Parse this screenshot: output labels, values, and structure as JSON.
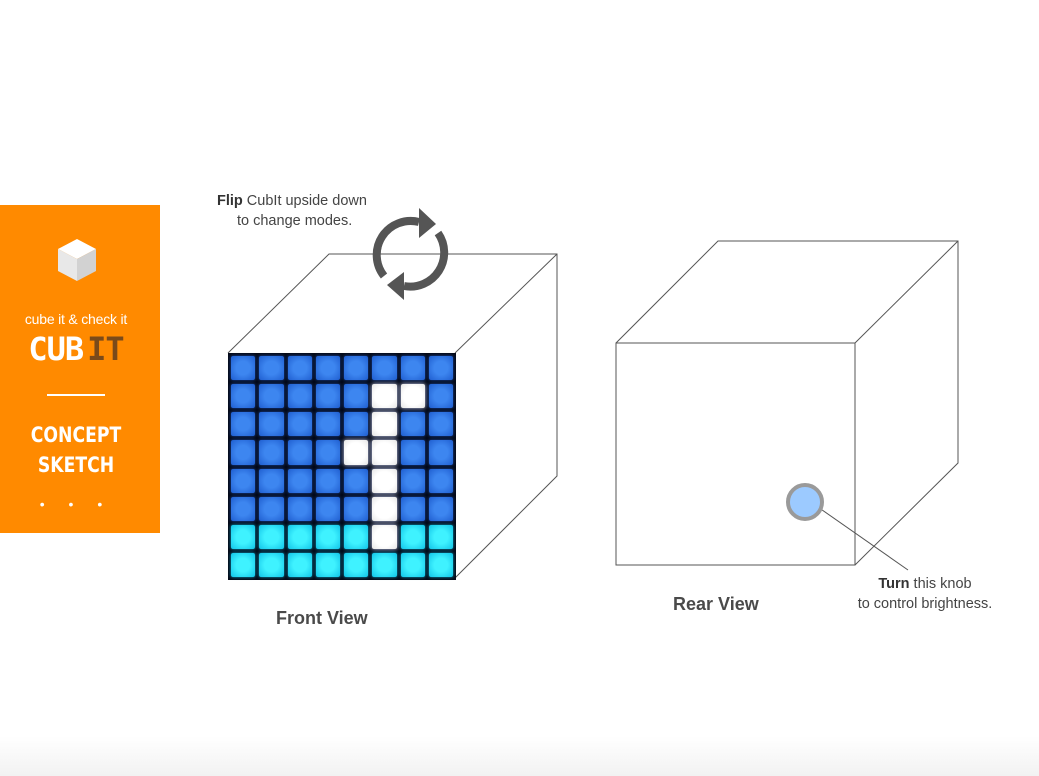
{
  "sidebar": {
    "tagline": "cube it & check it",
    "brand_part1": "CUB",
    "brand_part2": "IT",
    "section_line1": "CONCEPT",
    "section_line2": "SKETCH",
    "dots": "• • •",
    "background_color": "#ff8a00"
  },
  "flip_caption": {
    "bold": "Flip",
    "line1_rest": " CubIt upside down",
    "line2": "to change modes."
  },
  "knob_caption": {
    "bold": "Turn",
    "line1_rest": " this knob",
    "line2": "to control brightness."
  },
  "front_label": "Front View",
  "rear_label": "Rear View",
  "led_matrix": [
    [
      "blue",
      "blue",
      "blue",
      "blue",
      "blue",
      "blue",
      "blue",
      "blue"
    ],
    [
      "blue",
      "blue",
      "blue",
      "blue",
      "blue",
      "white",
      "white",
      "blue"
    ],
    [
      "blue",
      "blue",
      "blue",
      "blue",
      "blue",
      "white",
      "blue",
      "blue"
    ],
    [
      "blue",
      "blue",
      "blue",
      "blue",
      "white",
      "white",
      "blue",
      "blue"
    ],
    [
      "blue",
      "blue",
      "blue",
      "blue",
      "blue",
      "white",
      "blue",
      "blue"
    ],
    [
      "blue",
      "blue",
      "blue",
      "blue",
      "blue",
      "white",
      "blue",
      "blue"
    ],
    [
      "cyan",
      "cyan",
      "cyan",
      "cyan",
      "cyan",
      "white",
      "cyan",
      "cyan"
    ],
    [
      "cyan",
      "cyan",
      "cyan",
      "cyan",
      "cyan",
      "cyan",
      "cyan",
      "cyan"
    ]
  ],
  "colors": {
    "knob_fill": "#9ccaff",
    "knob_ring": "#9a9a9a",
    "rotate_icon": "#555555"
  }
}
